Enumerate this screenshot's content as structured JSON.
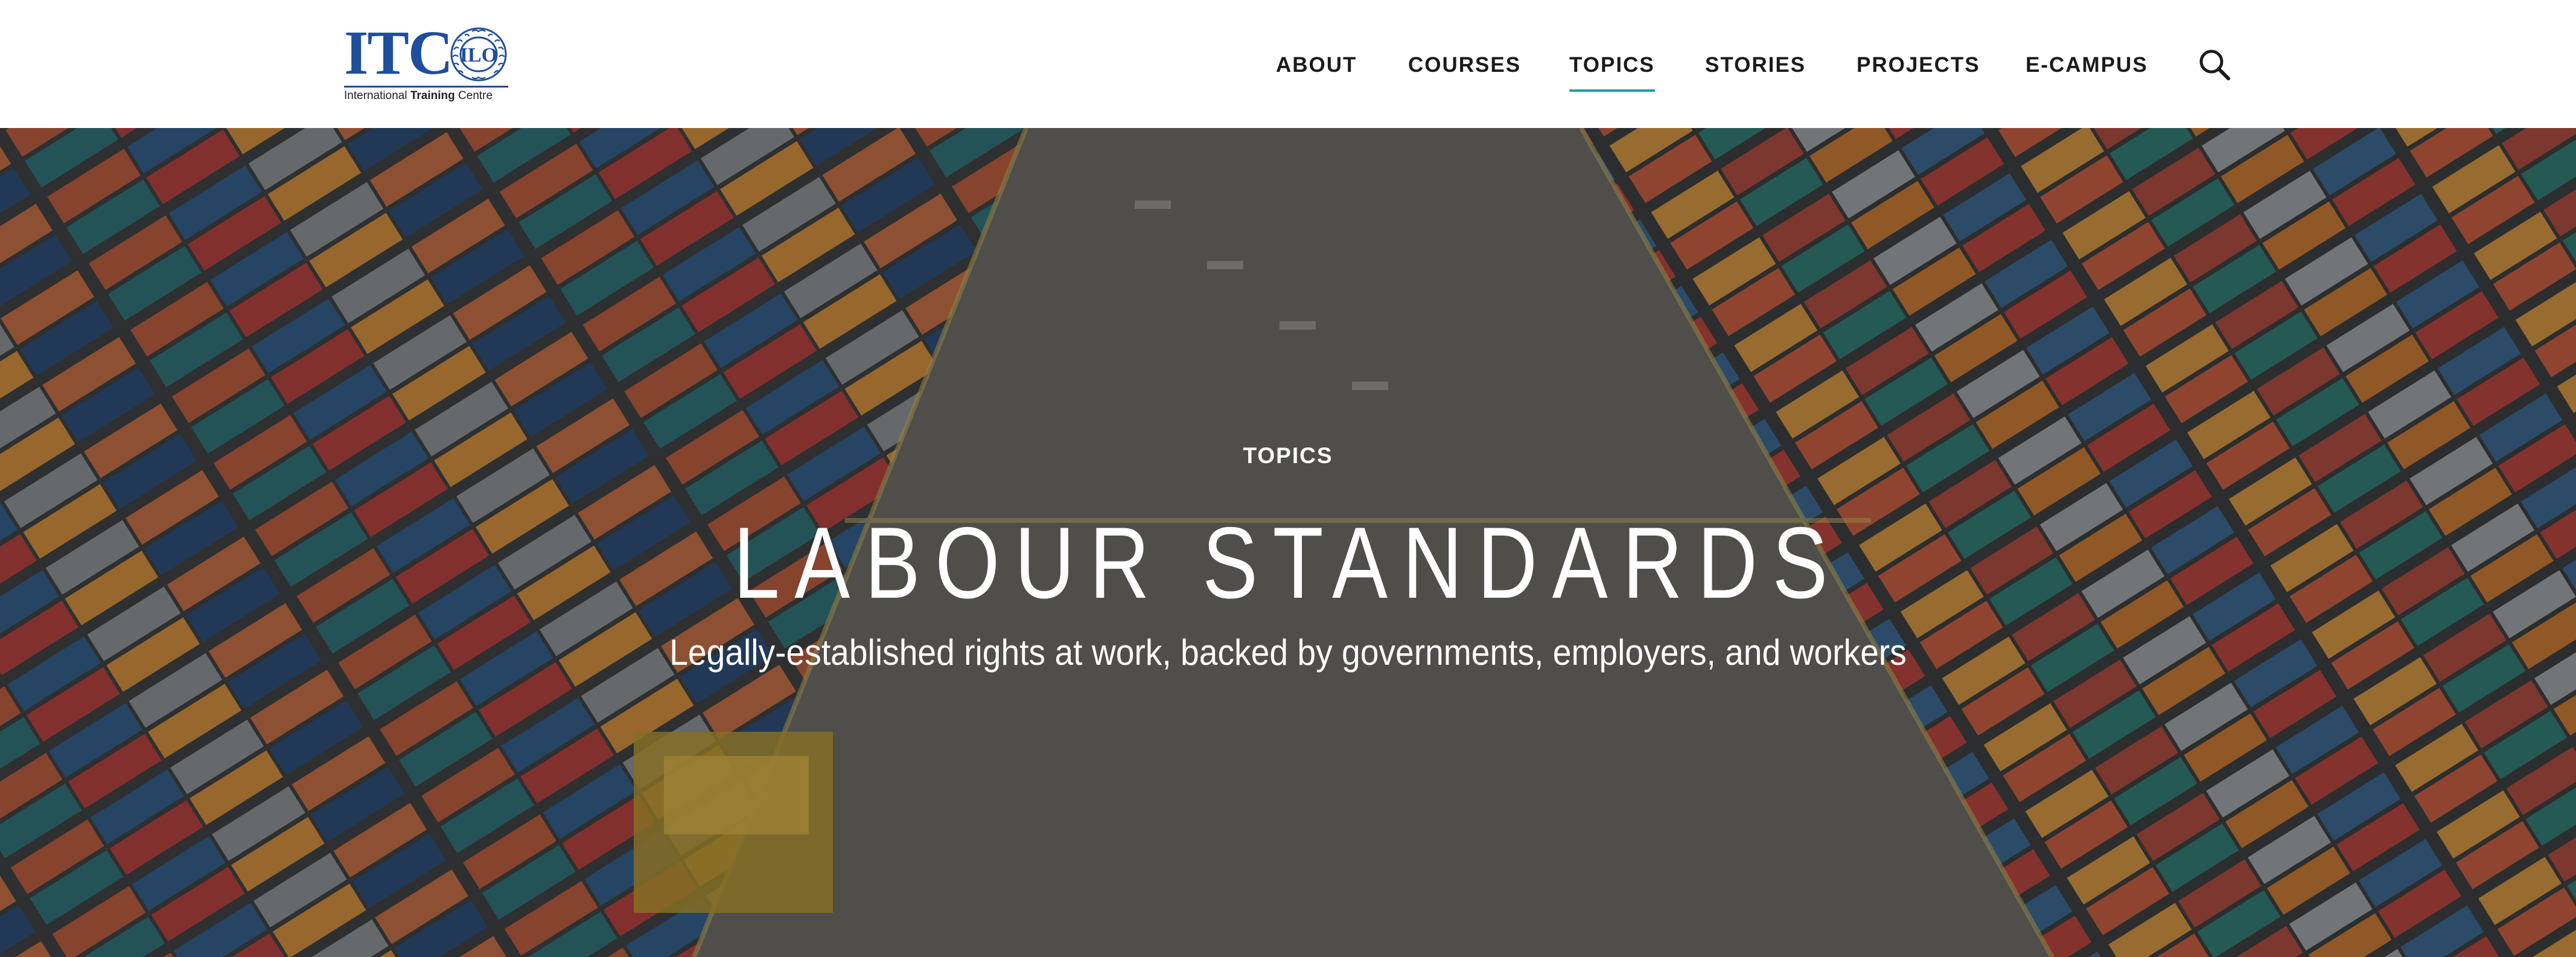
{
  "header": {
    "logo": {
      "mark": "ITC",
      "seal_text": "ILO",
      "subtitle_pre": "International ",
      "subtitle_bold": "Training",
      "subtitle_post": " Centre"
    },
    "nav": [
      {
        "label": "ABOUT",
        "active": false
      },
      {
        "label": "COURSES",
        "active": false
      },
      {
        "label": "TOPICS",
        "active": true
      },
      {
        "label": "STORIES",
        "active": false
      },
      {
        "label": "PROJECTS",
        "active": false
      },
      {
        "label": "E-CAMPUS",
        "active": false
      }
    ],
    "search_icon": "search-icon"
  },
  "hero": {
    "eyebrow": "TOPICS",
    "title": "LABOUR STANDARDS",
    "subtitle": "Legally-established rights at work, backed by governments, employers, and workers",
    "image_subject": "aerial view of shipping container port"
  },
  "colors": {
    "brand_blue": "#1f4e9c",
    "nav_text": "#1b1b1b",
    "active_underline": "#1aa0aa",
    "hero_text": "#ffffff"
  }
}
